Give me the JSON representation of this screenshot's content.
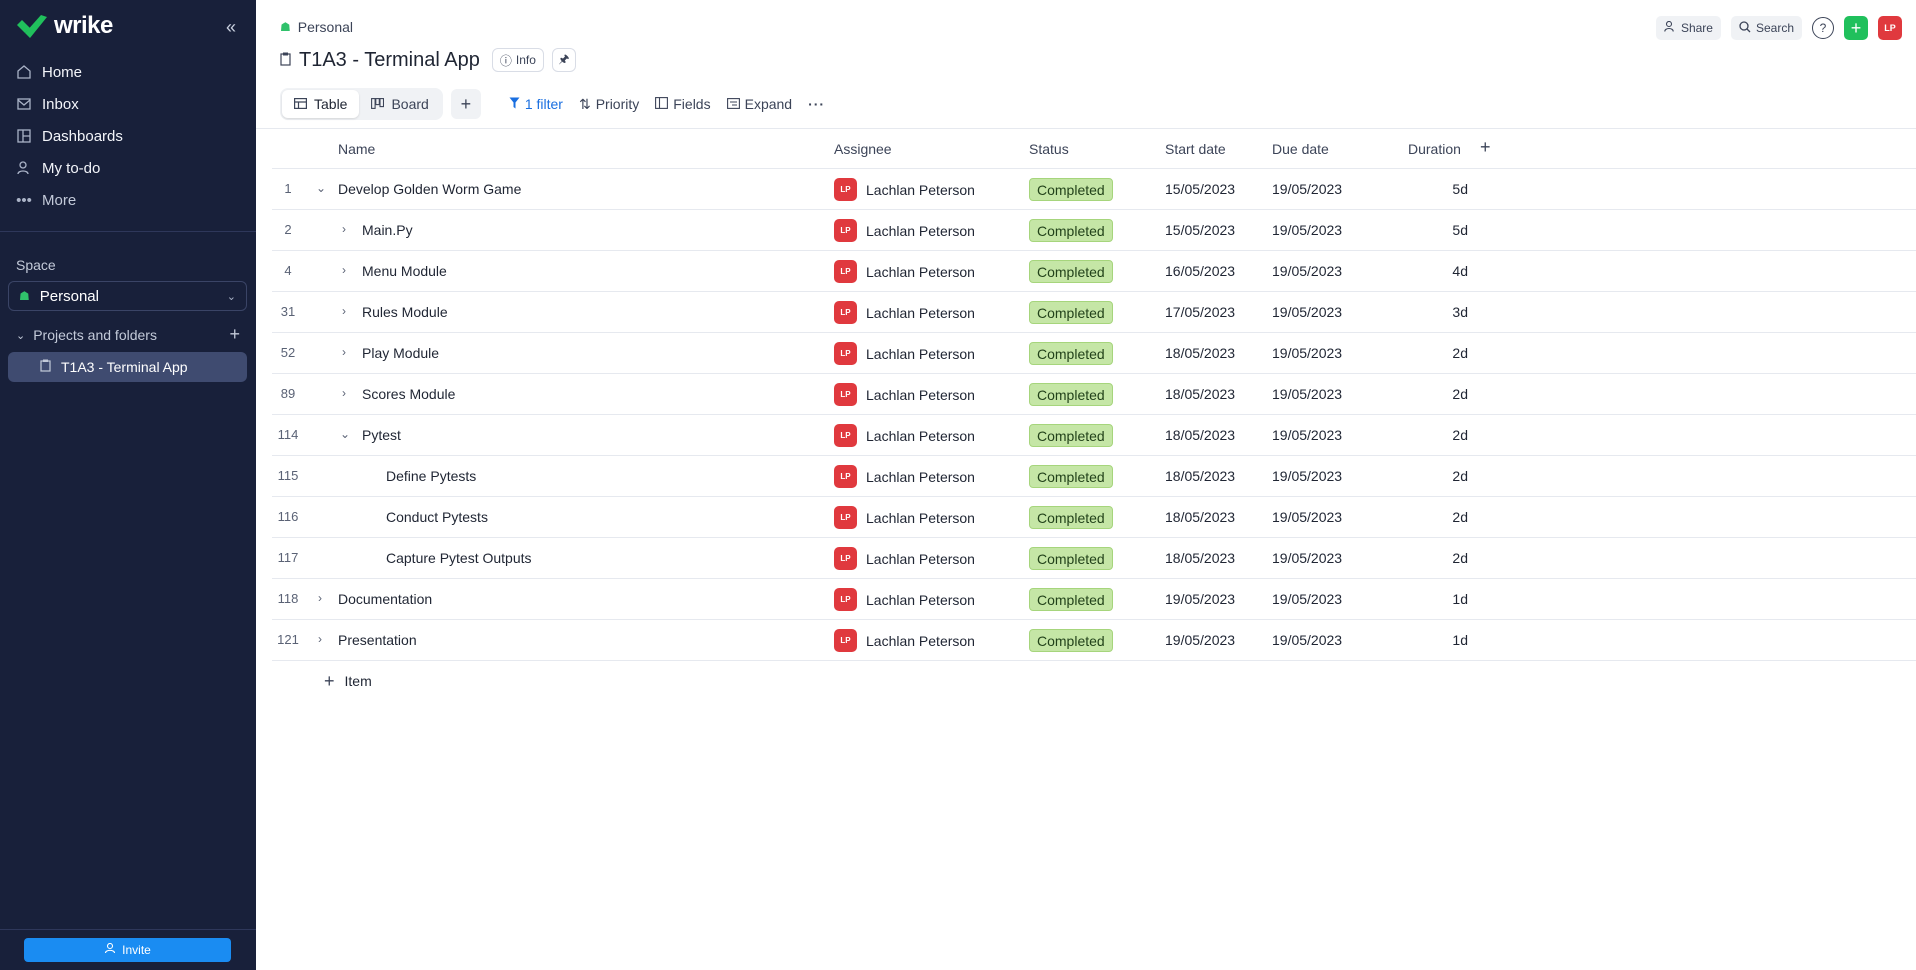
{
  "sidebar": {
    "logo_text": "wrike",
    "nav": [
      {
        "label": "Home"
      },
      {
        "label": "Inbox"
      },
      {
        "label": "Dashboards"
      },
      {
        "label": "My to-do"
      },
      {
        "label": "More"
      }
    ],
    "space_label": "Space",
    "space_name": "Personal",
    "projects_header": "Projects and folders",
    "project_item": "T1A3 - Terminal App",
    "invite_label": "Invite"
  },
  "header": {
    "breadcrumb": "Personal",
    "title": "T1A3 - Terminal App",
    "info_label": "Info",
    "share_label": "Share",
    "search_label": "Search",
    "user_initials": "LP"
  },
  "toolbar": {
    "table_label": "Table",
    "board_label": "Board",
    "filter_label": "1 filter",
    "priority_label": "Priority",
    "fields_label": "Fields",
    "expand_label": "Expand"
  },
  "table": {
    "columns": {
      "name": "Name",
      "assignee": "Assignee",
      "status": "Status",
      "start": "Start date",
      "due": "Due date",
      "duration": "Duration"
    },
    "rows": [
      {
        "id": "1",
        "name": "Develop Golden Worm Game",
        "level": 0,
        "expander": "expanded",
        "initials": "LP",
        "assignee": "Lachlan Peterson",
        "status": "Completed",
        "start": "15/05/2023",
        "due": "19/05/2023",
        "duration": "5d"
      },
      {
        "id": "2",
        "name": "Main.Py",
        "level": 1,
        "expander": "collapsed",
        "initials": "LP",
        "assignee": "Lachlan Peterson",
        "status": "Completed",
        "start": "15/05/2023",
        "due": "19/05/2023",
        "duration": "5d"
      },
      {
        "id": "4",
        "name": "Menu Module",
        "level": 1,
        "expander": "collapsed",
        "initials": "LP",
        "assignee": "Lachlan Peterson",
        "status": "Completed",
        "start": "16/05/2023",
        "due": "19/05/2023",
        "duration": "4d"
      },
      {
        "id": "31",
        "name": "Rules Module",
        "level": 1,
        "expander": "collapsed",
        "initials": "LP",
        "assignee": "Lachlan Peterson",
        "status": "Completed",
        "start": "17/05/2023",
        "due": "19/05/2023",
        "duration": "3d"
      },
      {
        "id": "52",
        "name": "Play Module",
        "level": 1,
        "expander": "collapsed",
        "initials": "LP",
        "assignee": "Lachlan Peterson",
        "status": "Completed",
        "start": "18/05/2023",
        "due": "19/05/2023",
        "duration": "2d"
      },
      {
        "id": "89",
        "name": "Scores Module",
        "level": 1,
        "expander": "collapsed",
        "initials": "LP",
        "assignee": "Lachlan Peterson",
        "status": "Completed",
        "start": "18/05/2023",
        "due": "19/05/2023",
        "duration": "2d"
      },
      {
        "id": "114",
        "name": "Pytest",
        "level": 1,
        "expander": "expanded",
        "initials": "LP",
        "assignee": "Lachlan Peterson",
        "status": "Completed",
        "start": "18/05/2023",
        "due": "19/05/2023",
        "duration": "2d"
      },
      {
        "id": "115",
        "name": "Define Pytests",
        "level": 2,
        "expander": "none",
        "initials": "LP",
        "assignee": "Lachlan Peterson",
        "status": "Completed",
        "start": "18/05/2023",
        "due": "19/05/2023",
        "duration": "2d"
      },
      {
        "id": "116",
        "name": "Conduct Pytests",
        "level": 2,
        "expander": "none",
        "initials": "LP",
        "assignee": "Lachlan Peterson",
        "status": "Completed",
        "start": "18/05/2023",
        "due": "19/05/2023",
        "duration": "2d"
      },
      {
        "id": "117",
        "name": "Capture Pytest Outputs",
        "level": 2,
        "expander": "none",
        "initials": "LP",
        "assignee": "Lachlan Peterson",
        "status": "Completed",
        "start": "18/05/2023",
        "due": "19/05/2023",
        "duration": "2d"
      },
      {
        "id": "118",
        "name": "Documentation",
        "level": 0,
        "expander": "collapsed",
        "initials": "LP",
        "assignee": "Lachlan Peterson",
        "status": "Completed",
        "start": "19/05/2023",
        "due": "19/05/2023",
        "duration": "1d"
      },
      {
        "id": "121",
        "name": "Presentation",
        "level": 0,
        "expander": "collapsed",
        "initials": "LP",
        "assignee": "Lachlan Peterson",
        "status": "Completed",
        "start": "19/05/2023",
        "due": "19/05/2023",
        "duration": "1d"
      }
    ],
    "add_item_label": "Item"
  },
  "colors": {
    "sidebar_bg": "#18203a",
    "accent_green": "#20c05c",
    "accent_blue": "#1a8cf2",
    "status_completed": "#c5e6a6",
    "avatar_red": "#e0393e"
  }
}
